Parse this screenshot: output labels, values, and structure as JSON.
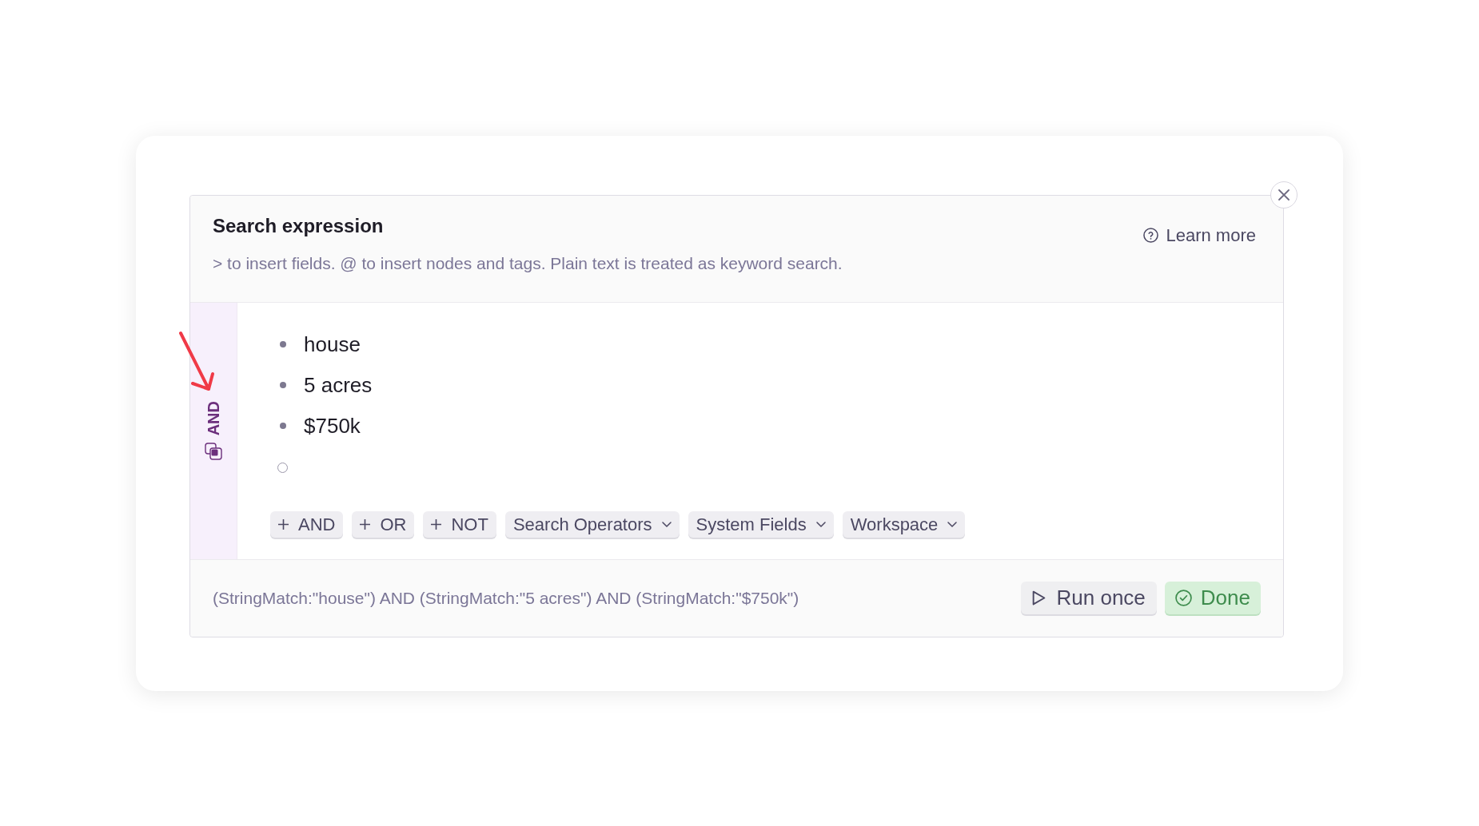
{
  "panel": {
    "title": "Search expression",
    "learn_more": "Learn more",
    "hint": "> to insert fields. @ to insert nodes and tags. Plain text is treated as keyword search."
  },
  "group": {
    "operator": "AND",
    "items": [
      {
        "kind": "term",
        "text": "house"
      },
      {
        "kind": "term",
        "text": "5 acres"
      },
      {
        "kind": "term",
        "text": "$750k"
      },
      {
        "kind": "empty"
      }
    ]
  },
  "toolbar": [
    {
      "kind": "add",
      "label": "AND"
    },
    {
      "kind": "add",
      "label": "OR"
    },
    {
      "kind": "add",
      "label": "NOT"
    },
    {
      "kind": "menu",
      "label": "Search Operators"
    },
    {
      "kind": "menu",
      "label": "System Fields"
    },
    {
      "kind": "menu",
      "label": "Workspace"
    }
  ],
  "footer": {
    "query": "(StringMatch:\"house\") AND (StringMatch:\"5 acres\") AND (StringMatch:\"$750k\")",
    "actions": [
      {
        "kind": "run",
        "label": "Run once"
      },
      {
        "kind": "done",
        "label": "Done"
      }
    ]
  }
}
